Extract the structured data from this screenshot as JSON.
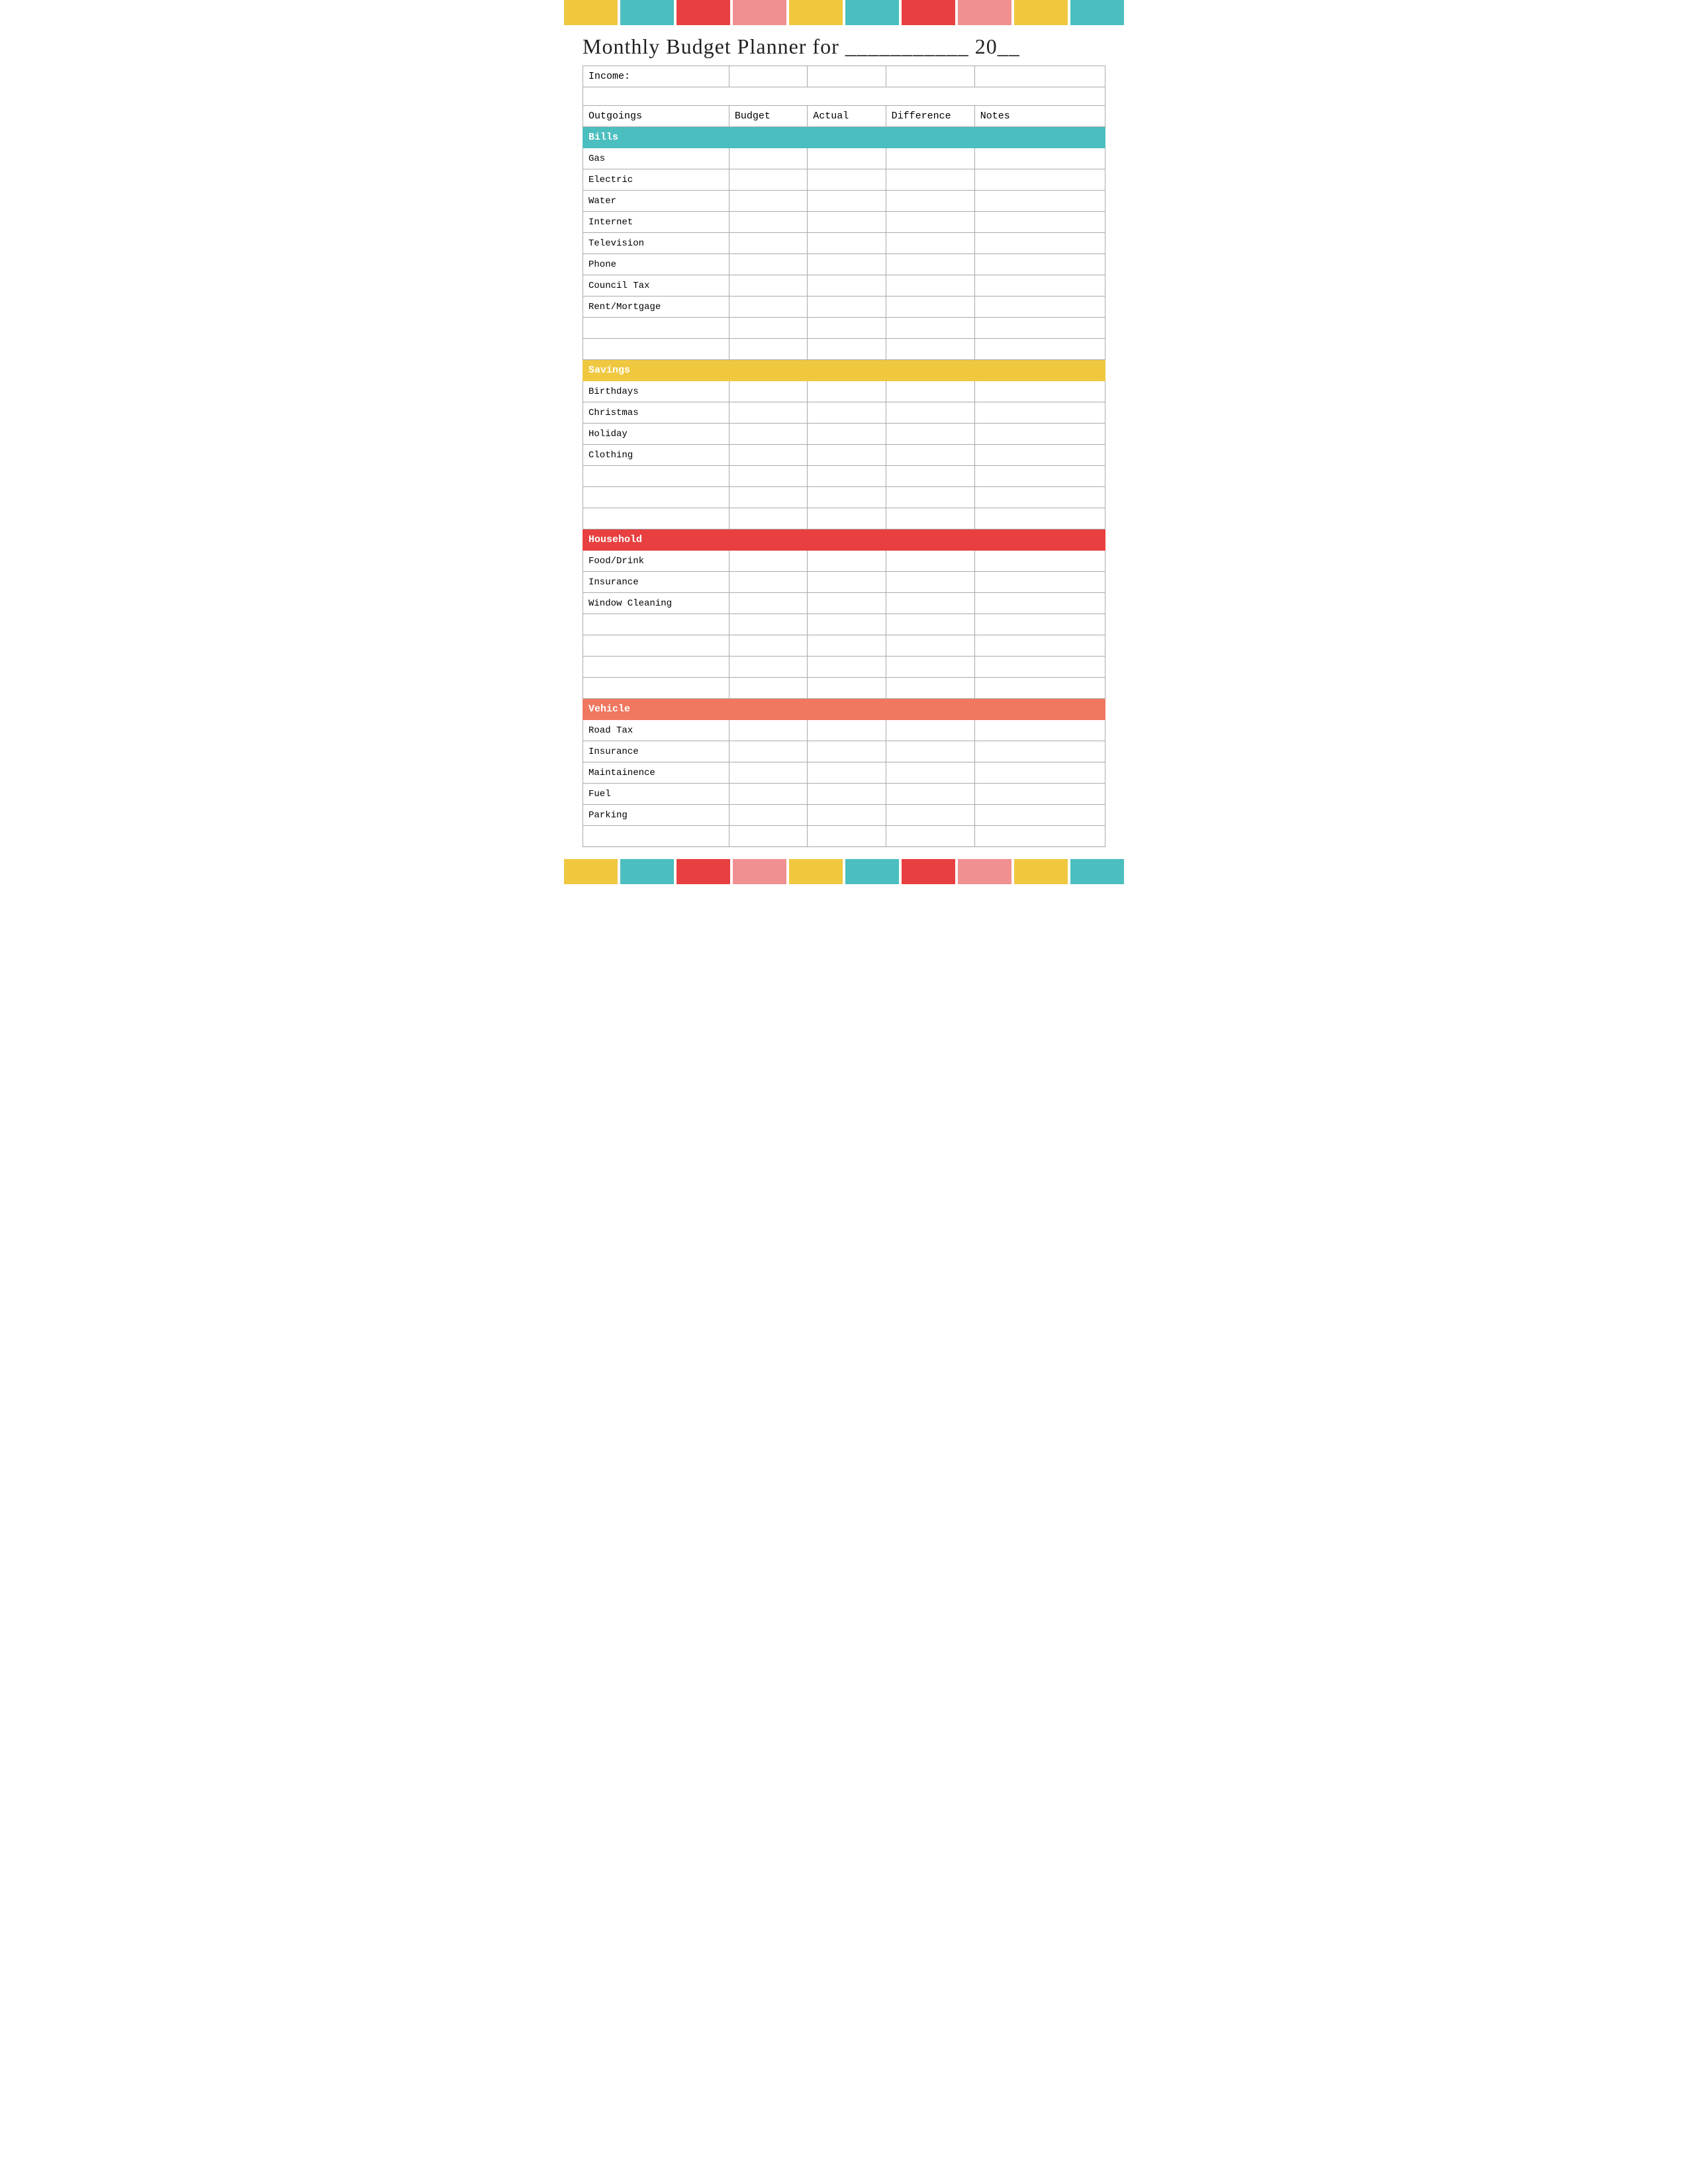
{
  "title": "Monthly Budget Planner for ___________ 20__",
  "colors": {
    "teal": "#4bbfbf",
    "yellow": "#f0c840",
    "red": "#e84040",
    "pink": "#f09090",
    "coral": "#f07860",
    "dark_teal": "#3a9898"
  },
  "top_bars": [
    "#f0c840",
    "#4bbfbf",
    "#e84040",
    "#f09090",
    "#f0c840",
    "#4bbfbf",
    "#e84040",
    "#f09090",
    "#f0c840",
    "#4bbfbf"
  ],
  "bottom_bars": [
    "#f0c840",
    "#4bbfbf",
    "#e84040",
    "#f09090",
    "#f0c840",
    "#4bbfbf",
    "#e84040",
    "#f09090",
    "#f0c840",
    "#4bbfbf"
  ],
  "columns": {
    "label": "Outgoings",
    "budget": "Budget",
    "actual": "Actual",
    "difference": "Difference",
    "notes": "Notes"
  },
  "income_label": "Income:",
  "sections": {
    "bills": {
      "header": "Bills",
      "items": [
        "Gas",
        "Electric",
        "Water",
        "Internet",
        "Television",
        "Phone",
        "Council Tax",
        "Rent/Mortgage",
        "",
        ""
      ]
    },
    "savings": {
      "header": "Savings",
      "items": [
        "Birthdays",
        "Christmas",
        "Holiday",
        "Clothing",
        "",
        "",
        ""
      ]
    },
    "household": {
      "header": "Household",
      "items": [
        "Food/Drink",
        "Insurance",
        "Window Cleaning",
        "",
        "",
        "",
        ""
      ]
    },
    "vehicle": {
      "header": "Vehicle",
      "items": [
        "Road Tax",
        "Insurance",
        "Maintainence",
        "Fuel",
        "Parking",
        ""
      ]
    }
  }
}
